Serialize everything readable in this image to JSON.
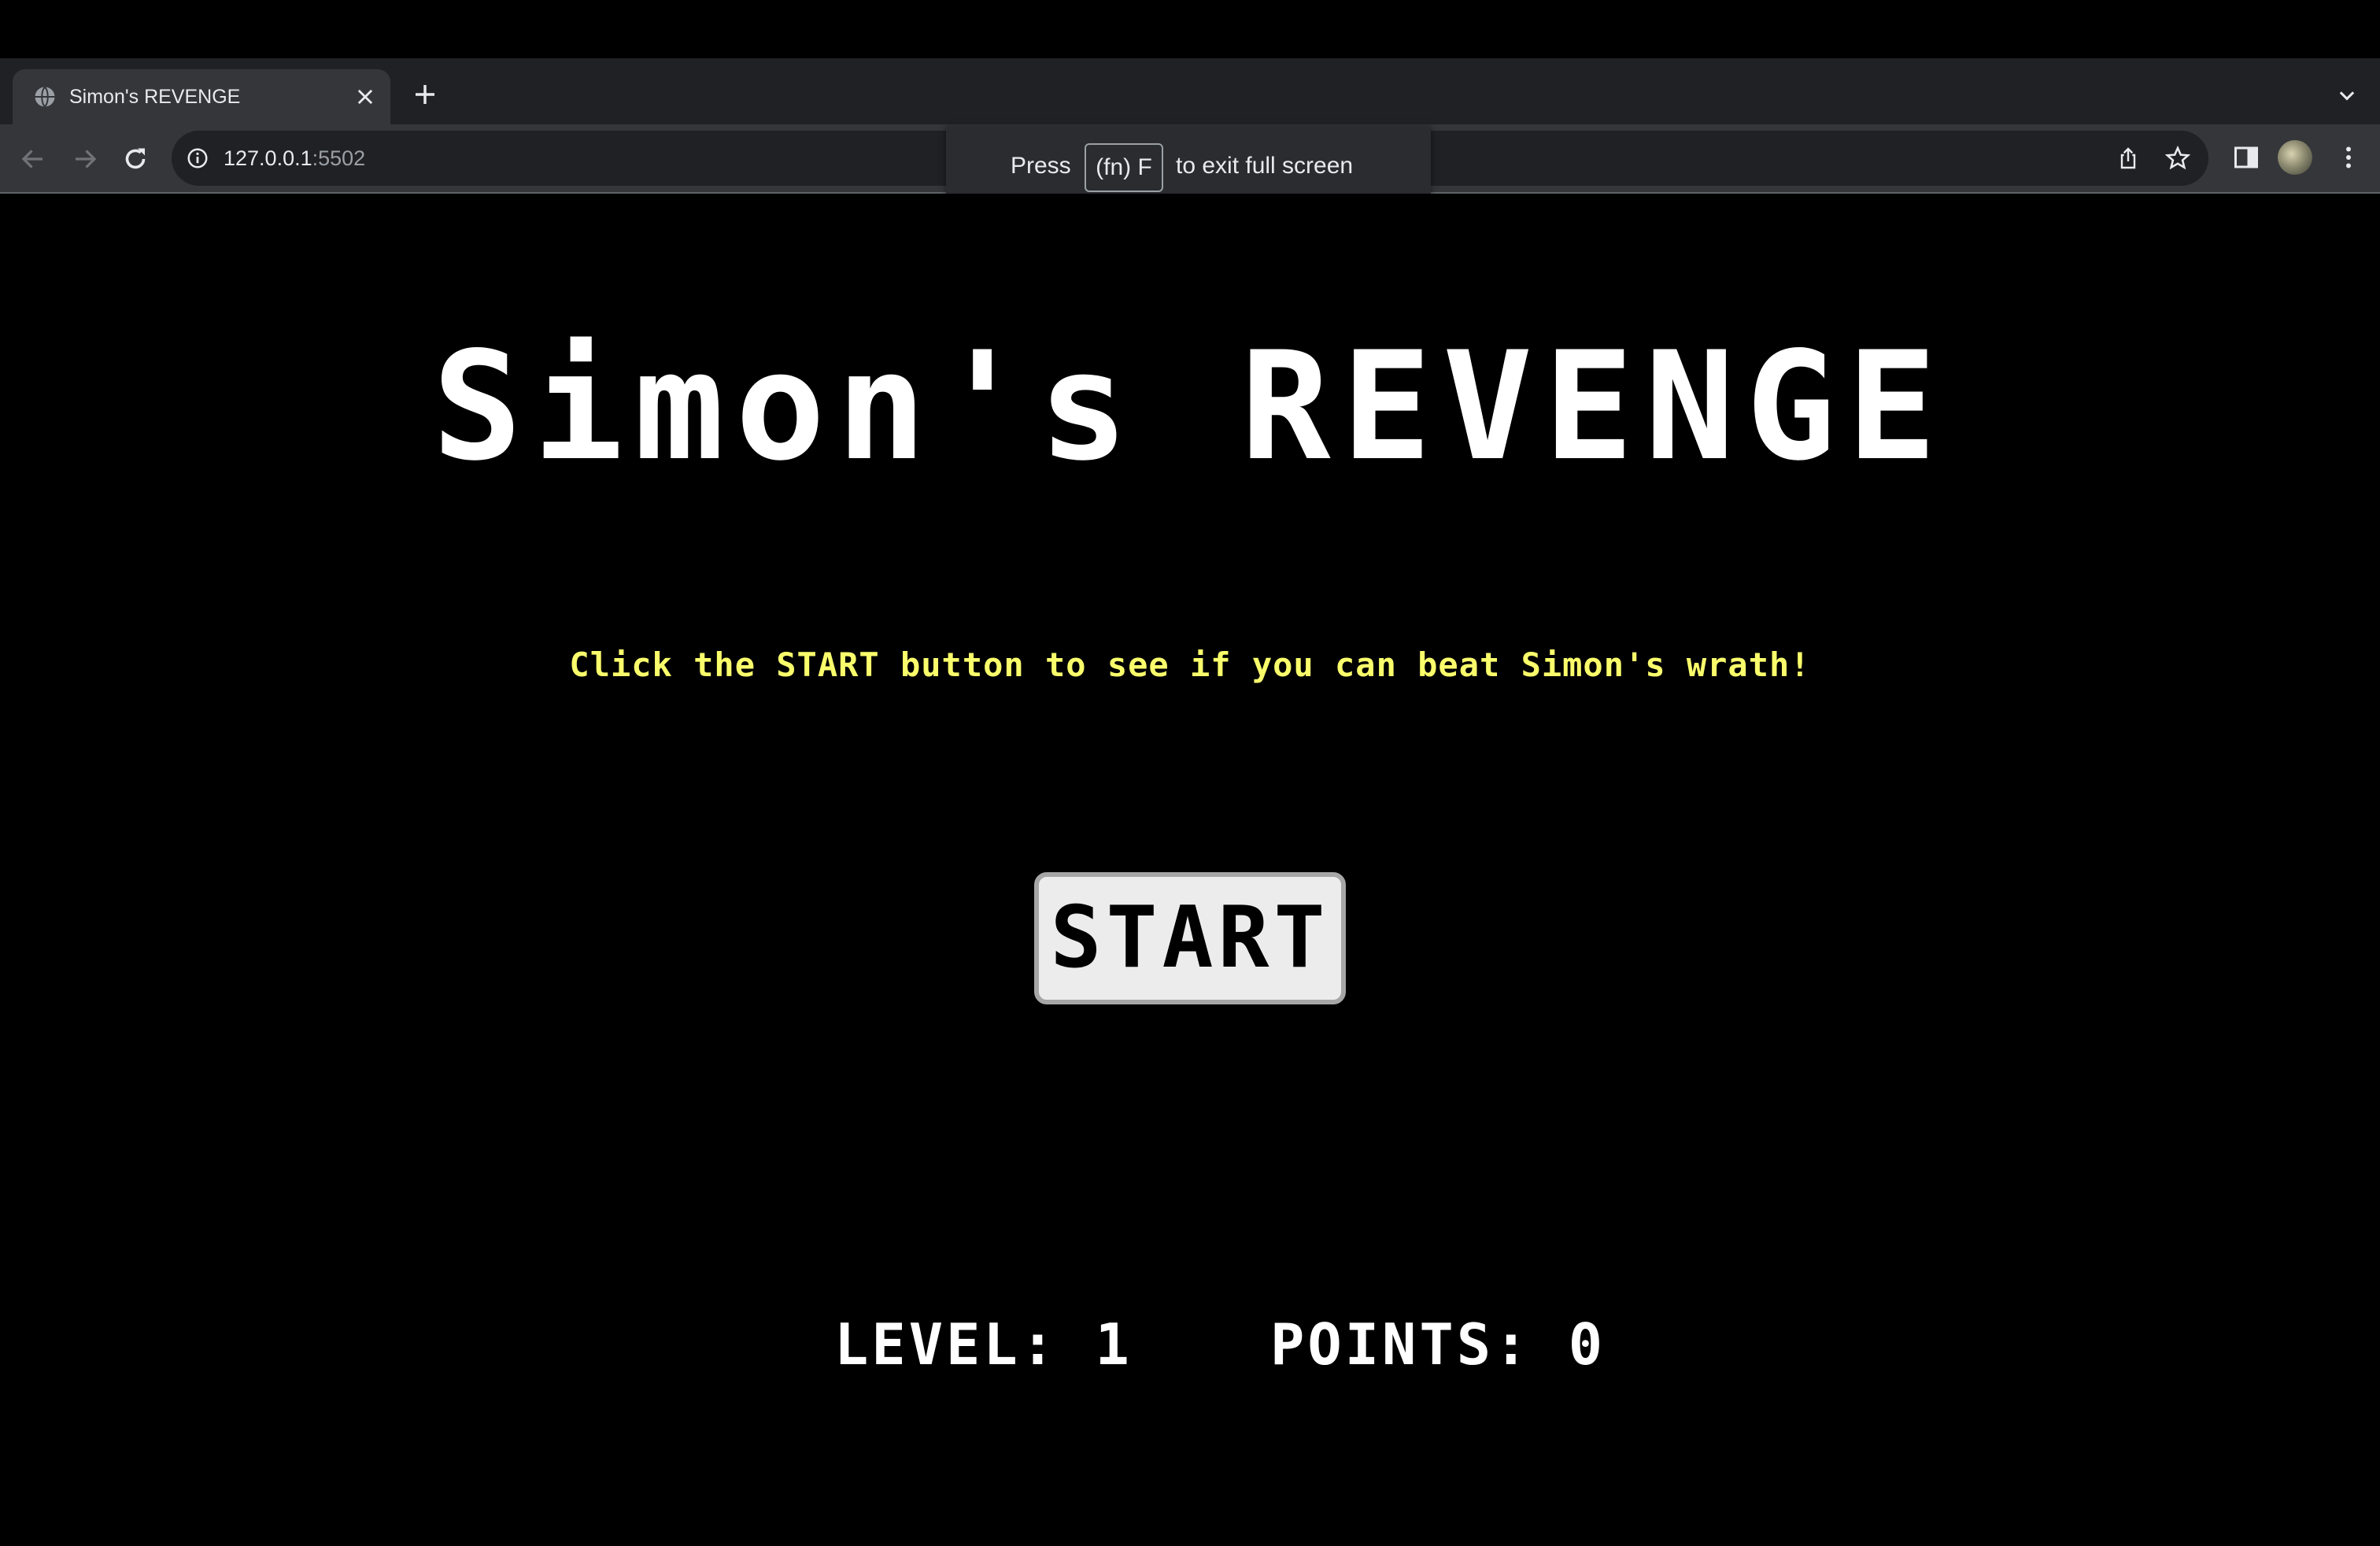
{
  "browser": {
    "tab_title": "Simon's REVENGE",
    "url_host": "127.0.0.1",
    "url_port": ":5502",
    "fullscreen_notice": {
      "prefix": "Press",
      "key": "(fn) F",
      "suffix": "to exit full screen"
    },
    "icons": [
      "globe-icon",
      "close-icon",
      "plus-icon",
      "chevron-down-icon",
      "back-icon",
      "forward-icon",
      "reload-icon",
      "info-icon",
      "share-icon",
      "star-icon",
      "side-panel-icon",
      "menu-dots-icon"
    ]
  },
  "game": {
    "title": "Simon's REVENGE",
    "instruction": "Click the START button to see if you can beat Simon's wrath!",
    "start_label": "START",
    "level_label": "LEVEL:",
    "level_value": "1",
    "points_label": "POINTS:",
    "points_value": "0"
  },
  "colors": {
    "background": "#000000",
    "title": "#ffffff",
    "instruction": "#fafd6b",
    "button_bg": "#ececec",
    "button_border": "#a6a6a6"
  }
}
